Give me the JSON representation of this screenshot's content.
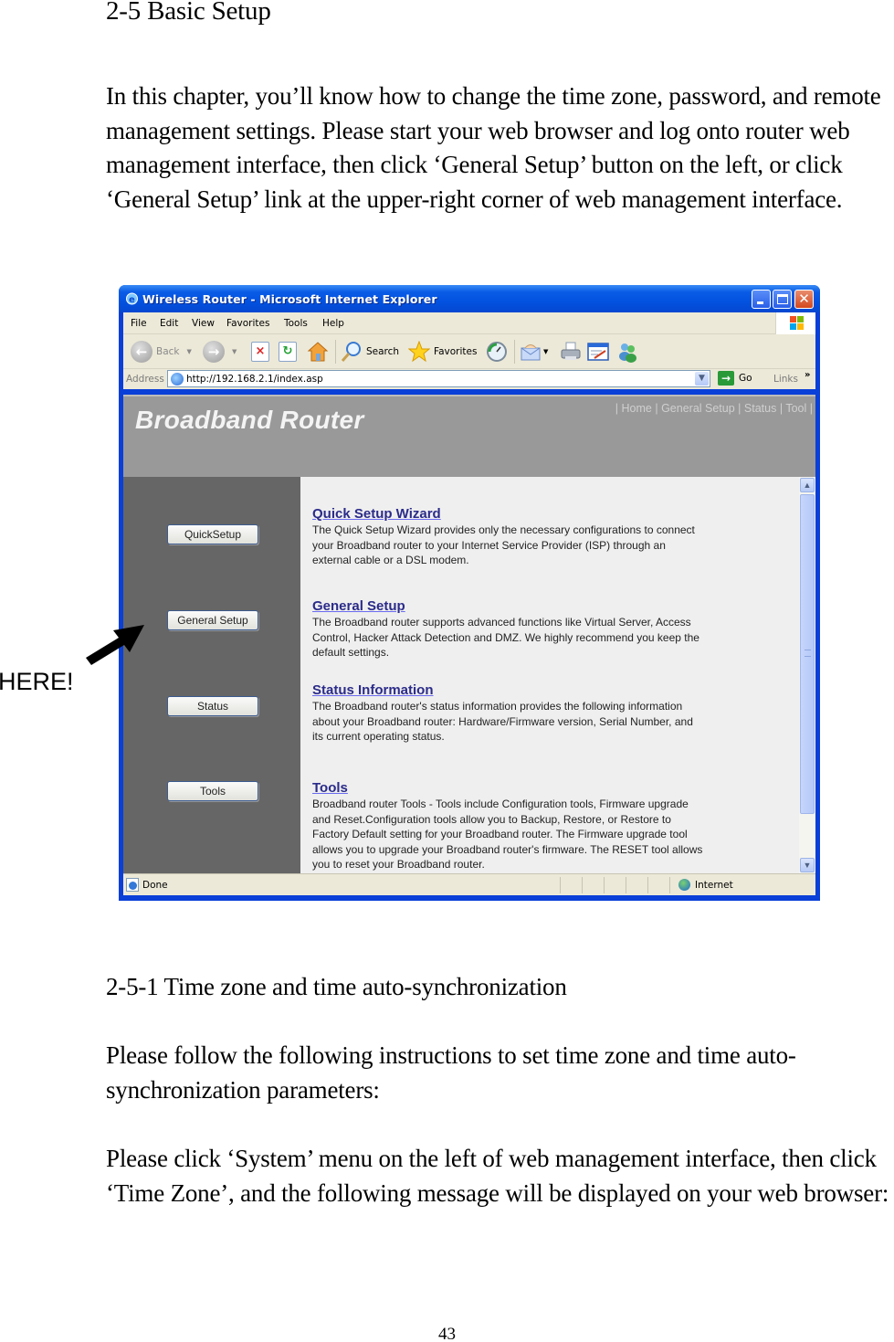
{
  "document": {
    "section_heading": "2-5 Basic Setup",
    "intro_paragraph": "In this chapter, you’ll know how to change the time zone, password, and remote management settings. Please start your web browser and log onto router web management interface, then click ‘General Setup’ button on the left, or click ‘General Setup’ link at the upper-right corner of web management interface.",
    "subsection_heading": "2-5-1 Time zone and time auto-synchronization",
    "follow_paragraph": "Please follow the following instructions to set time zone and time auto-synchronization parameters:",
    "click_paragraph": "Please click ‘System’ menu on the left of web management interface, then click ‘Time Zone’, and the following message will be displayed on your web browser:",
    "page_number": "43",
    "annotation_label": "HERE!"
  },
  "browser": {
    "window_title": "Wireless Router - Microsoft Internet Explorer",
    "window_buttons": {
      "minimize": "minimize-icon",
      "maximize": "maximize-icon",
      "close": "✕"
    },
    "menu": [
      "File",
      "Edit",
      "View",
      "Favorites",
      "Tools",
      "Help"
    ],
    "toolbar": {
      "back": "Back",
      "search": "Search",
      "favorites": "Favorites"
    },
    "address": {
      "label": "Address",
      "url": "http://192.168.2.1/index.asp",
      "go": "Go",
      "links": "Links",
      "links_chevron": "»"
    },
    "status": {
      "text": "Done",
      "zone": "Internet"
    }
  },
  "router_page": {
    "title": "Broadband Router",
    "top_links": [
      "Home",
      "General Setup",
      "Status",
      "Tool"
    ],
    "side_buttons": [
      "QuickSetup",
      "General Setup",
      "Status",
      "Tools"
    ],
    "sections": [
      {
        "title": "Quick Setup Wizard",
        "description": "The Quick Setup Wizard provides only the necessary configurations to connect your Broadband router to your Internet Service Provider (ISP) through an external cable or a DSL modem."
      },
      {
        "title": "General Setup",
        "description": "The Broadband router supports advanced functions like Virtual Server, Access Control, Hacker Attack Detection and DMZ. We highly recommend you keep the default settings."
      },
      {
        "title": "Status Information",
        "description": "The Broadband router's status information provides the following information about your Broadband router: Hardware/Firmware version, Serial Number, and its current operating status."
      },
      {
        "title": "Tools",
        "description": "Broadband router Tools - Tools include Configuration tools, Firmware upgrade and Reset.Configuration tools allow you to Backup, Restore, or Restore to Factory Default setting for your Broadband router. The Firmware upgrade tool allows you to upgrade your Broadband router's firmware. The RESET tool allows you to reset your Broadband router."
      }
    ]
  },
  "colors": {
    "titlebar_blue": "#0352e0",
    "header_gray": "#999999",
    "sidebar_gray": "#666666",
    "content_bg": "#efefef",
    "link_color": "#2b2b8a"
  }
}
